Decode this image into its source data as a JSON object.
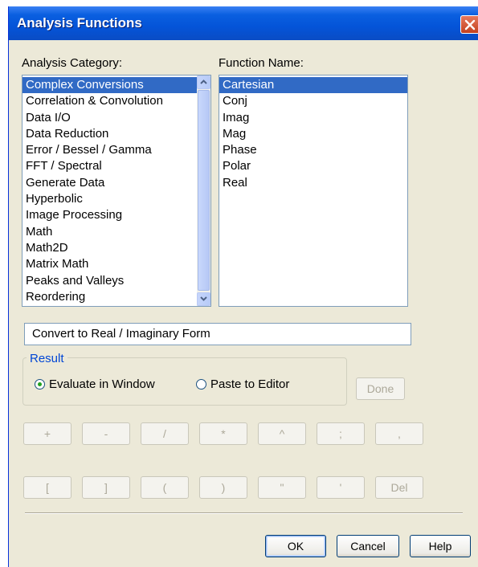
{
  "window": {
    "title": "Analysis Functions"
  },
  "category": {
    "label": "Analysis Category:",
    "selected": "Complex Conversions",
    "items": [
      "Complex Conversions",
      "Correlation & Convolution",
      "Data I/O",
      "Data Reduction",
      "Error / Bessel / Gamma",
      "FFT / Spectral",
      "Generate Data",
      "Hyperbolic",
      "Image Processing",
      "Math",
      "Math2D",
      "Matrix Math",
      "Peaks and Valleys",
      "Reordering"
    ]
  },
  "function": {
    "label": "Function Name:",
    "selected": "Cartesian",
    "items": [
      "Cartesian",
      "Conj",
      "Imag",
      "Mag",
      "Phase",
      "Polar",
      "Real"
    ]
  },
  "description": "Convert to Real / Imaginary Form",
  "result": {
    "label": "Result",
    "options": [
      "Evaluate in Window",
      "Paste to Editor"
    ],
    "selected": "Evaluate in Window"
  },
  "done_label": "Done",
  "keypad": {
    "row1": [
      "+",
      "-",
      "/",
      "*",
      "^",
      ";",
      ","
    ],
    "row2": [
      "[",
      "]",
      "(",
      ")",
      "\"",
      "'",
      "Del"
    ]
  },
  "buttons": {
    "ok": "OK",
    "cancel": "Cancel",
    "help": "Help"
  },
  "colors": {
    "title_bar": "#0454d8",
    "selection": "#316ac5",
    "dialog_bg": "#ece9d8",
    "group_label": "#0046d5"
  }
}
